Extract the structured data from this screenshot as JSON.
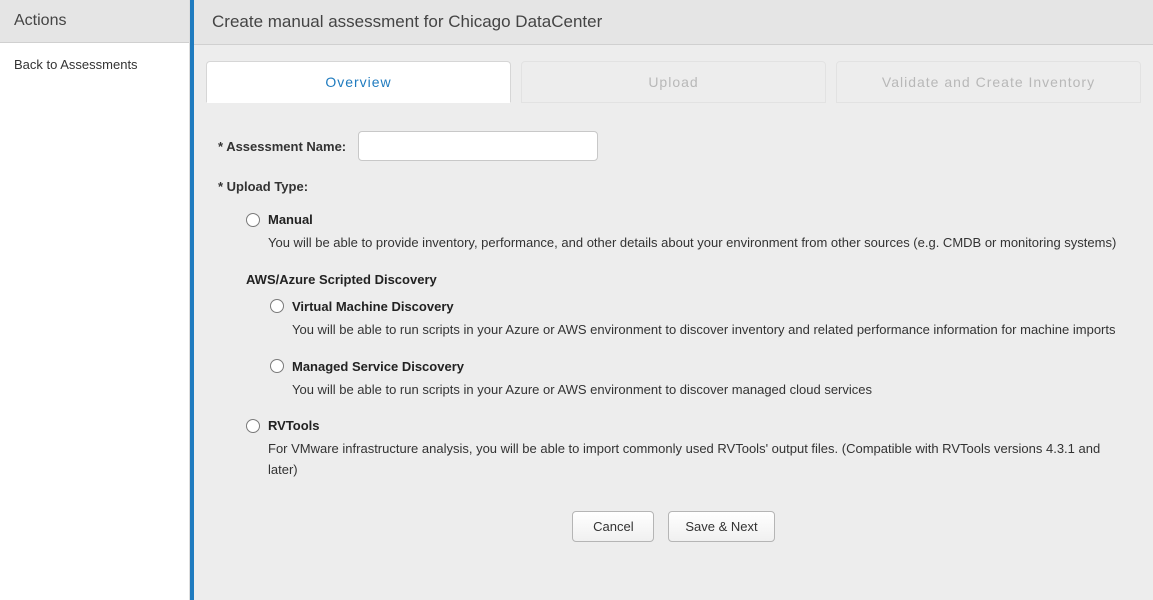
{
  "sidebar": {
    "title": "Actions",
    "backLink": "Back to Assessments"
  },
  "header": {
    "title": "Create manual assessment for Chicago DataCenter"
  },
  "tabs": [
    {
      "label": "Overview",
      "active": true
    },
    {
      "label": "Upload",
      "active": false
    },
    {
      "label": "Validate and Create Inventory",
      "active": false
    }
  ],
  "form": {
    "assessmentNameLabel": "* Assessment Name:",
    "assessmentNameValue": "",
    "uploadTypeLabel": "* Upload Type:",
    "options": {
      "manual": {
        "title": "Manual",
        "desc": "You will be able to provide inventory, performance, and other details about your environment from other sources (e.g. CMDB or monitoring systems)"
      },
      "scriptedGroup": {
        "title": "AWS/Azure Scripted Discovery",
        "vm": {
          "title": "Virtual Machine Discovery",
          "desc": "You will be able to run scripts in your Azure or AWS environment to discover inventory and related performance information for machine imports"
        },
        "managed": {
          "title": "Managed Service Discovery",
          "desc": "You will be able to run scripts in your Azure or AWS environment to discover managed cloud services"
        }
      },
      "rvtools": {
        "title": "RVTools",
        "desc": "For VMware infrastructure analysis, you will be able to import commonly used RVTools' output files. (Compatible with RVTools versions 4.3.1 and later)"
      }
    }
  },
  "buttons": {
    "cancel": "Cancel",
    "saveNext": "Save & Next"
  }
}
